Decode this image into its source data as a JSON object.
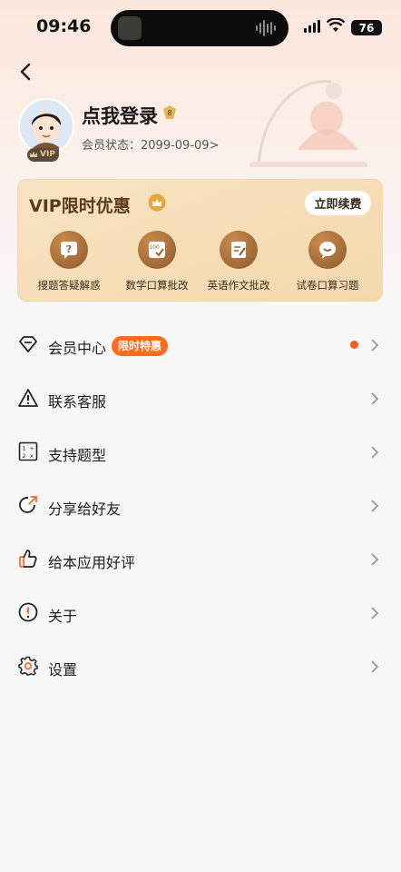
{
  "status_bar": {
    "time": "09:46",
    "battery": "76"
  },
  "profile": {
    "login_label": "点我登录",
    "level": "8",
    "vip_badge": "VIP",
    "member_status_label": "会员状态：",
    "member_status_value": "2099-09-09>"
  },
  "vip_card": {
    "title": "VIP限时优惠",
    "renew_label": "立即续费",
    "features": [
      {
        "label": "搜题答疑解惑",
        "icon": "question-bubble-icon"
      },
      {
        "label": "数学口算批改",
        "icon": "math-check-icon"
      },
      {
        "label": "英语作文批改",
        "icon": "essay-pen-icon"
      },
      {
        "label": "试卷口算习题",
        "icon": "smile-bubble-icon"
      }
    ]
  },
  "menu": [
    {
      "label": "会员中心",
      "icon": "diamond-icon",
      "tag": "限时特惠",
      "has_dot": true
    },
    {
      "label": "联系客服",
      "icon": "warning-triangle-icon"
    },
    {
      "label": "支持题型",
      "icon": "math-grid-icon"
    },
    {
      "label": "分享给好友",
      "icon": "share-arrow-icon"
    },
    {
      "label": "给本应用好评",
      "icon": "thumbs-up-icon"
    },
    {
      "label": "关于",
      "icon": "info-circle-icon"
    },
    {
      "label": "设置",
      "icon": "gear-icon"
    }
  ],
  "colors": {
    "accent": "#ff6b1f",
    "vip_gold": "#f6ddb6",
    "vip_icon": "#9a6230",
    "background": "#f7f7f8"
  }
}
